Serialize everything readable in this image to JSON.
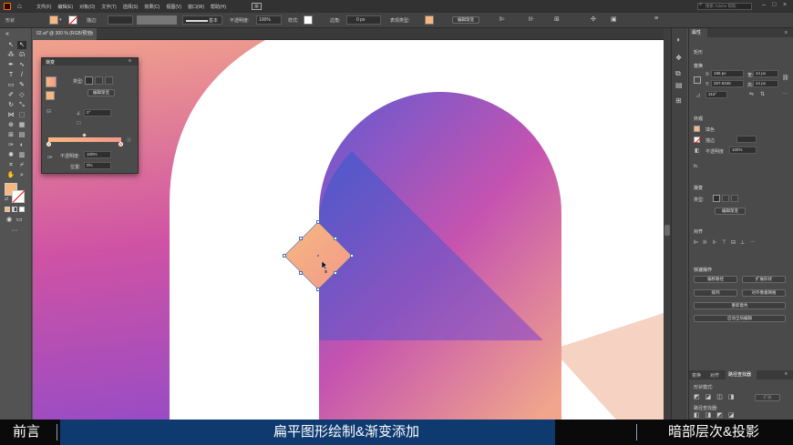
{
  "menu": {
    "items": [
      "文件(F)",
      "编辑(E)",
      "对象(O)",
      "文字(T)",
      "选择(S)",
      "效果(C)",
      "视图(V)",
      "窗口(W)",
      "帮助(H)"
    ],
    "search_placeholder": "搜索 Adobe 帮助"
  },
  "control": {
    "shape_label": "形状",
    "stroke_label": "描边:",
    "stroke_style": "基本",
    "opacity_label": "不透明度:",
    "opacity_value": "100%",
    "style_label": "样式:",
    "corner_label": "边角:",
    "corner_value": "0 px",
    "shape_type_label": "表现类型:",
    "edit_gradient": "编辑渐变"
  },
  "document": {
    "tab_title": "02.ai* @ 300 % (RGB/预览)"
  },
  "gradient_panel": {
    "title": "渐变",
    "type_label": "类型:",
    "edit_button": "编辑渐变",
    "angle_value": "0°",
    "opacity_label": "不透明度:",
    "opacity_value": "100%",
    "position_label": "位置:",
    "position_value": "0%",
    "stop_left_color": "#f7b880",
    "stop_right_color": "#f2998a"
  },
  "properties": {
    "tab": "属性",
    "section_shape": "矩形",
    "transform_title": "变换",
    "x_label": "X:",
    "x_value": "186 px",
    "y_label": "Y:",
    "y_value": "267.6346",
    "w_label": "宽:",
    "w_value": "44 px",
    "h_label": "高:",
    "h_value": "44 px",
    "angle_value": "315°",
    "appearance_title": "外观",
    "fill_label": "填色",
    "stroke_label": "描边",
    "opacity_label": "不透明度",
    "opacity_value": "100%",
    "fx_label": "fx.",
    "gradient_title": "渐变",
    "gradient_type_label": "类型:",
    "gradient_edit_button": "编辑渐变",
    "align_title": "对齐",
    "quick_actions_title": "快速操作",
    "qa_buttons": [
      "偏移路径",
      "扩展形状",
      "排列",
      "对齐像素网格",
      "重新着色",
      "启动全局编辑"
    ],
    "bottom_tabs": [
      "变换",
      "对齐",
      "路径查找器"
    ],
    "shape_modes_label": "形状模式:",
    "pathfinder_label": "路径查找器:",
    "expand_button": "扩展"
  },
  "caption": {
    "left": "前言",
    "middle": "扁平图形绘制&渐变添加",
    "right": "暗部层次&投影"
  },
  "colors": {
    "accent_left": "#f7b880",
    "accent_right": "#f2998a",
    "purple": "#7a55cc",
    "pink": "#d55aa8",
    "caption_blue": "#0e3a70"
  }
}
